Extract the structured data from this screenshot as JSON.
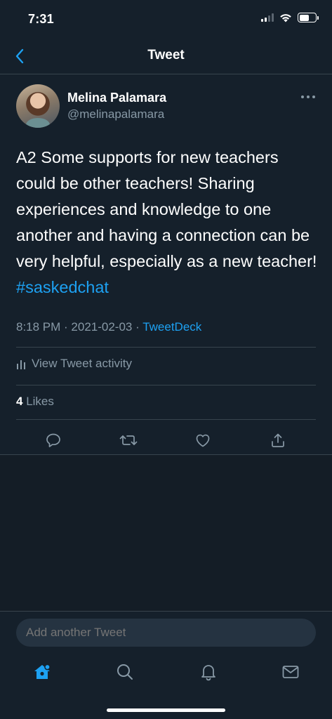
{
  "status_bar": {
    "time": "7:31"
  },
  "header": {
    "title": "Tweet"
  },
  "tweet": {
    "author": {
      "display_name": "Melina Palamara",
      "handle": "@melinapalamara"
    },
    "text": "A2 Some supports for new teachers could be other teachers! Sharing experiences and knowledge to one another and having a connection can be very helpful, especially as a new teacher! ",
    "hashtag": "#saskedchat",
    "meta": {
      "time": "8:18 PM",
      "date": "2021-02-03",
      "source": "TweetDeck",
      "separator": " · "
    },
    "activity_label": "View Tweet activity",
    "likes": {
      "count": "4",
      "label": "Likes"
    }
  },
  "reply_bar": {
    "placeholder": "Add another Tweet"
  },
  "colors": {
    "background": "#15202b",
    "accent": "#1da1f2",
    "secondary_text": "#8899a6",
    "divider": "#38444d"
  },
  "icons": [
    "back-icon",
    "more-icon",
    "activity-icon",
    "reply-icon",
    "retweet-icon",
    "like-icon",
    "share-icon",
    "home-icon",
    "search-icon",
    "notifications-icon",
    "messages-icon"
  ]
}
